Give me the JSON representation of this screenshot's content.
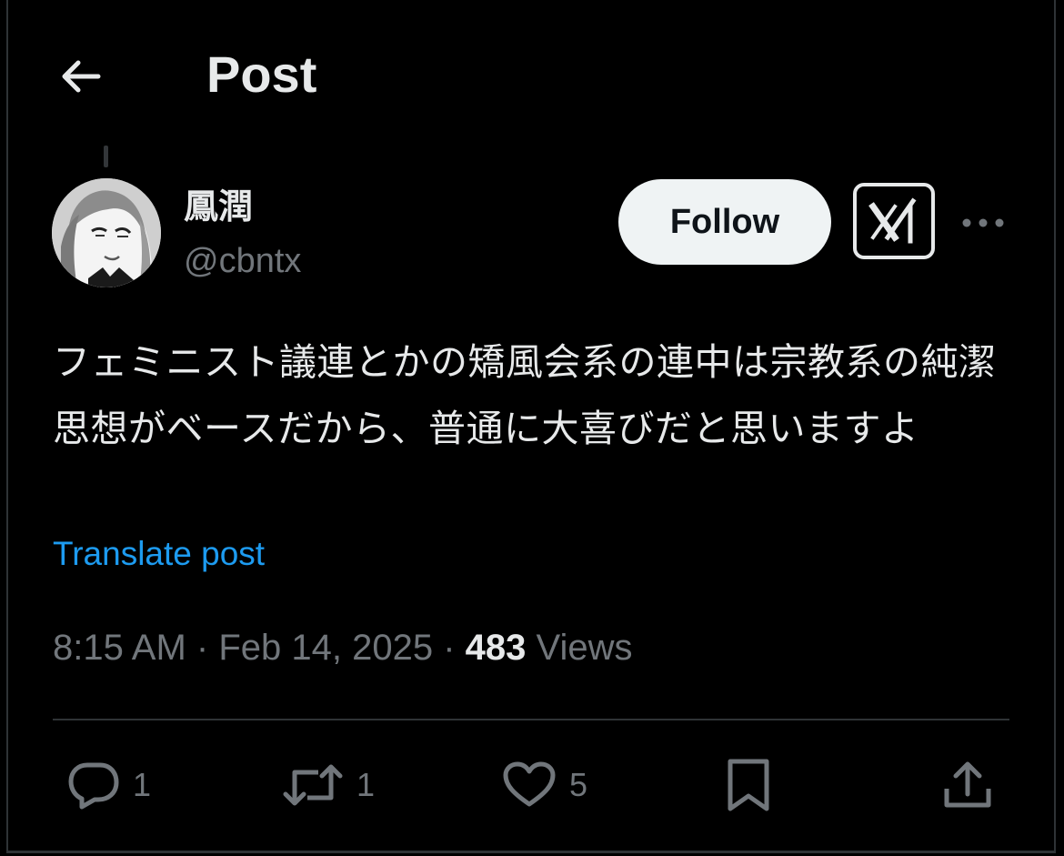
{
  "header": {
    "title": "Post",
    "back_icon": "arrow-left-icon"
  },
  "author": {
    "display_name": "鳳潤",
    "handle": "@cbntx"
  },
  "actions_top": {
    "follow_label": "Follow",
    "grok_icon": "grok-icon",
    "more_icon": "more-horizontal-icon"
  },
  "post": {
    "text": "フェミニスト議連とかの矯風会系の連中は宗教系の純潔思想がベースだから、普通に大喜びだと思いますよ",
    "translate_label": "Translate post",
    "time": "8:15 AM",
    "date": "Feb 14, 2025",
    "separator": "·",
    "views_count": "483",
    "views_label": "Views"
  },
  "engagement": {
    "replies": "1",
    "reposts": "1",
    "likes": "5"
  },
  "colors": {
    "background": "#000000",
    "text": "#e7e9ea",
    "secondary": "#71767b",
    "link": "#1d9bf0",
    "border": "#2f3336",
    "follow_bg": "#eff3f4"
  }
}
